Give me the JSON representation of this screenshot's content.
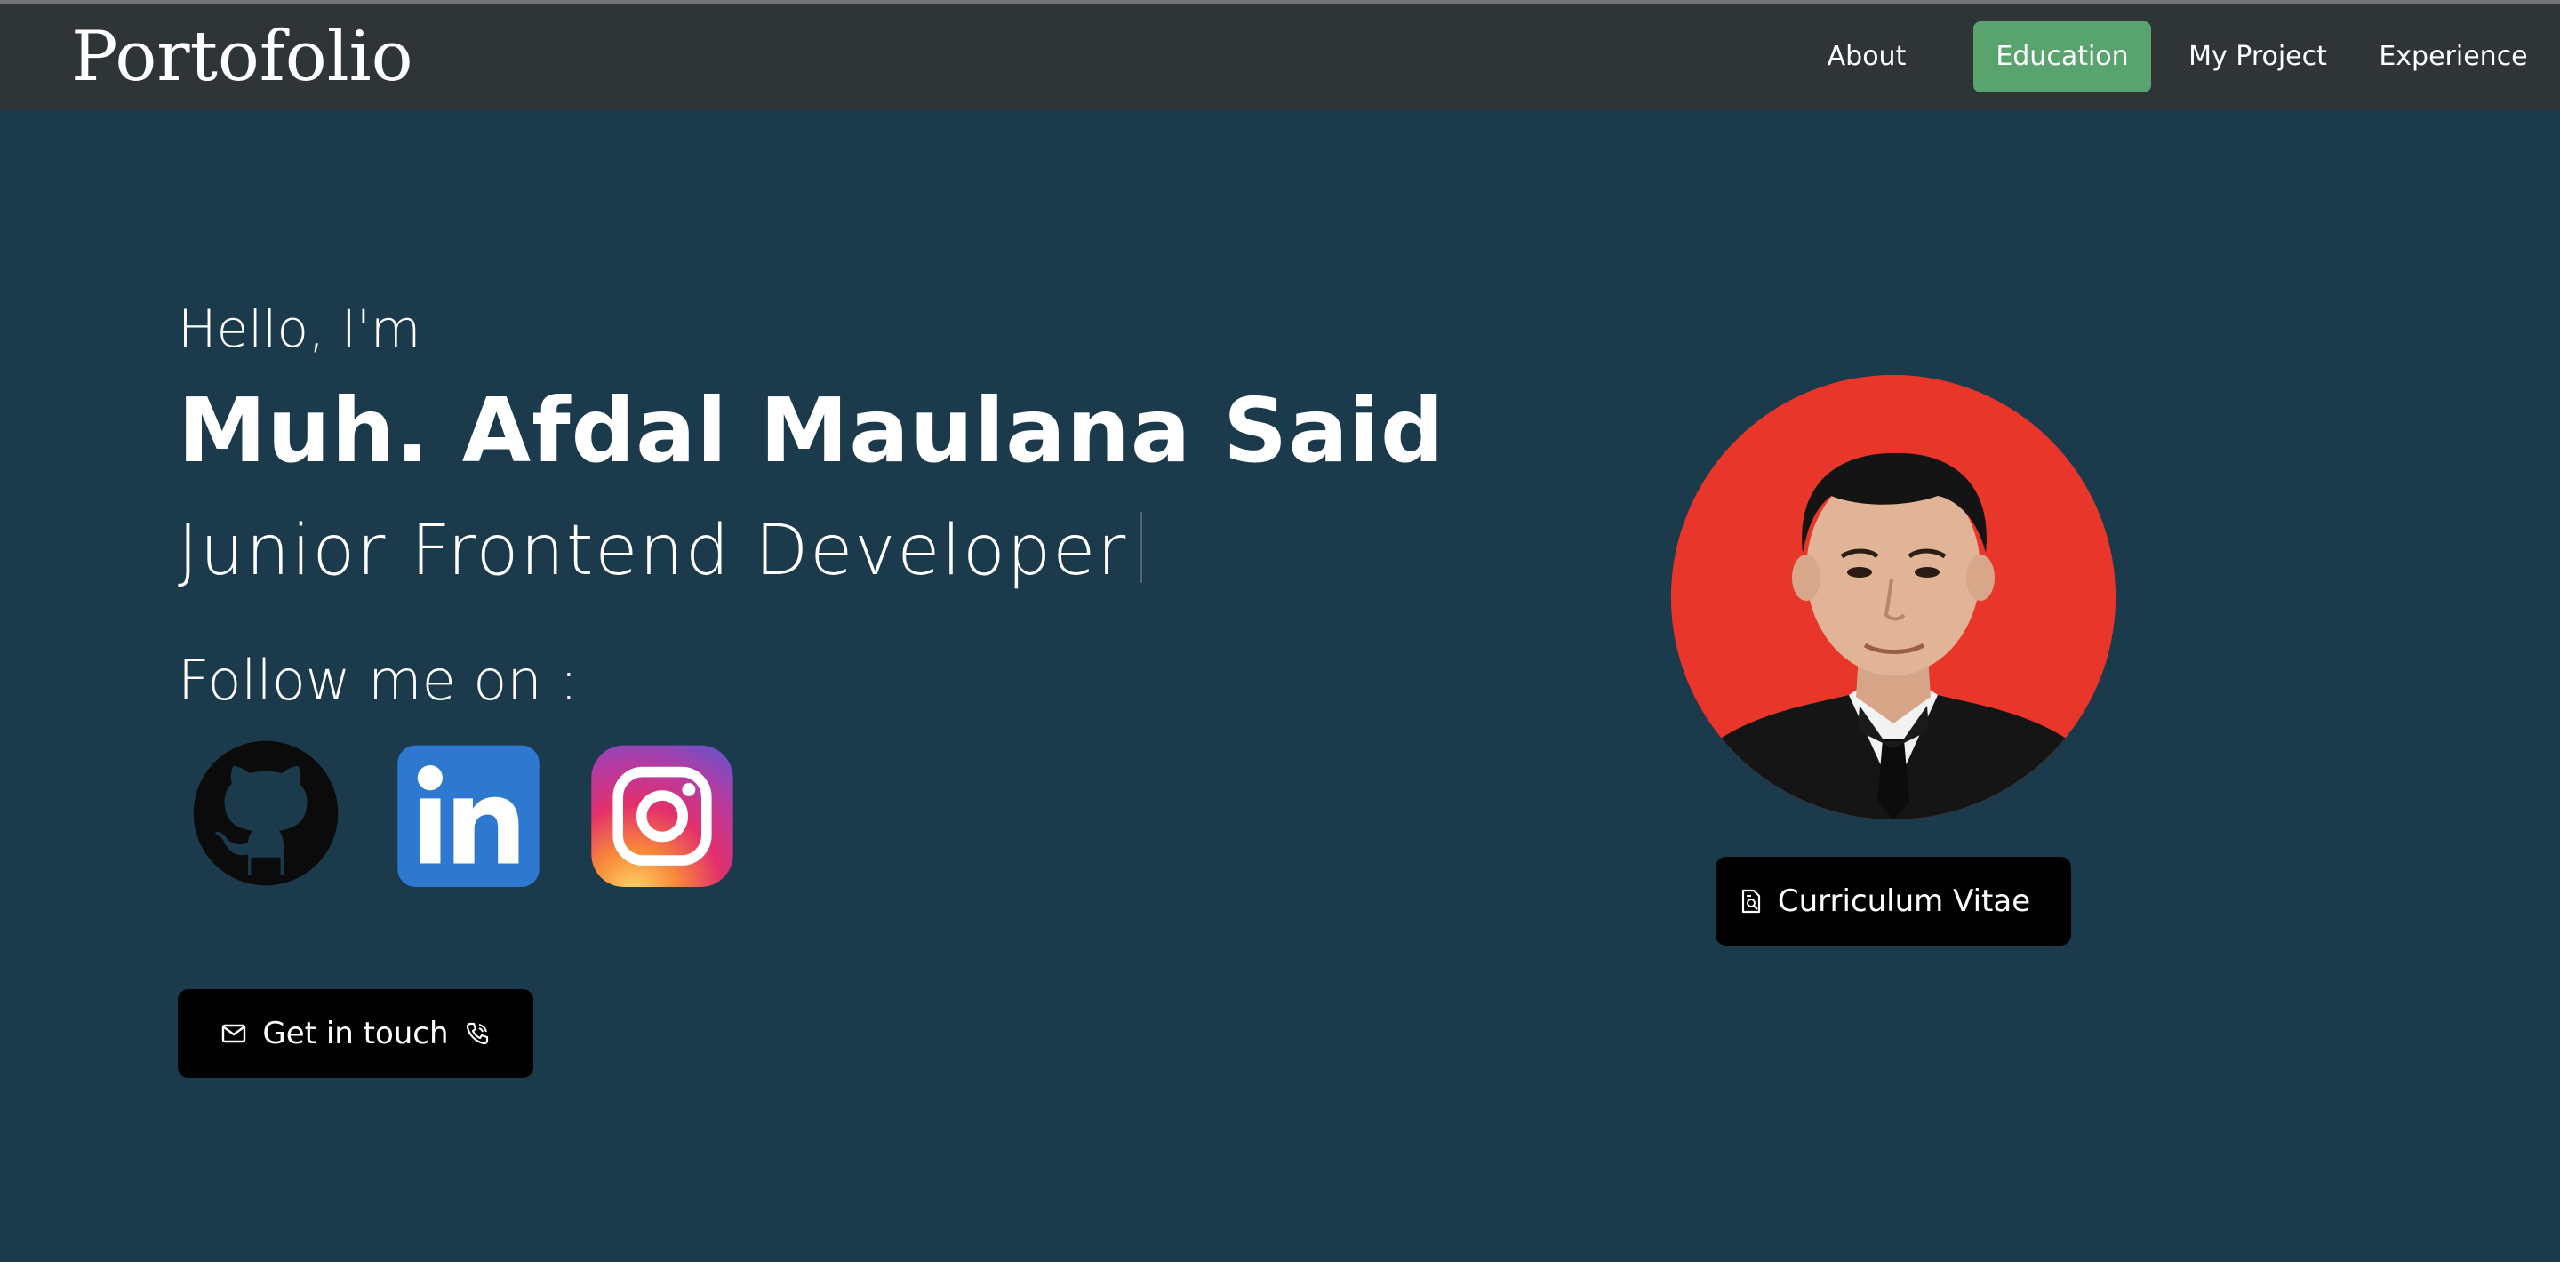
{
  "navbar": {
    "brand": "Portofolio",
    "items": [
      {
        "label": "About"
      },
      {
        "label": "Education",
        "active": true
      },
      {
        "label": "My Project"
      },
      {
        "label": "Experience"
      }
    ],
    "active_color": "#58a36e"
  },
  "hero": {
    "greeting": "Hello, I'm",
    "name": "Muh. Afdal Maulana Said",
    "role": "Junior Frontend Developer",
    "follow_label": "Follow me on :",
    "socials": [
      {
        "icon": "github-icon"
      },
      {
        "icon": "linkedin-icon"
      },
      {
        "icon": "instagram-icon"
      }
    ],
    "contact_button": {
      "label": "Get in touch",
      "icon_left": "mail-icon",
      "icon_right": "phone-icon"
    }
  },
  "profile": {
    "photo_background": "#e8372a",
    "cv_button": {
      "label": "Curriculum Vitae",
      "icon": "document-search-icon"
    }
  },
  "colors": {
    "background": "#1b3a4c",
    "navbar": "#2f3436"
  }
}
